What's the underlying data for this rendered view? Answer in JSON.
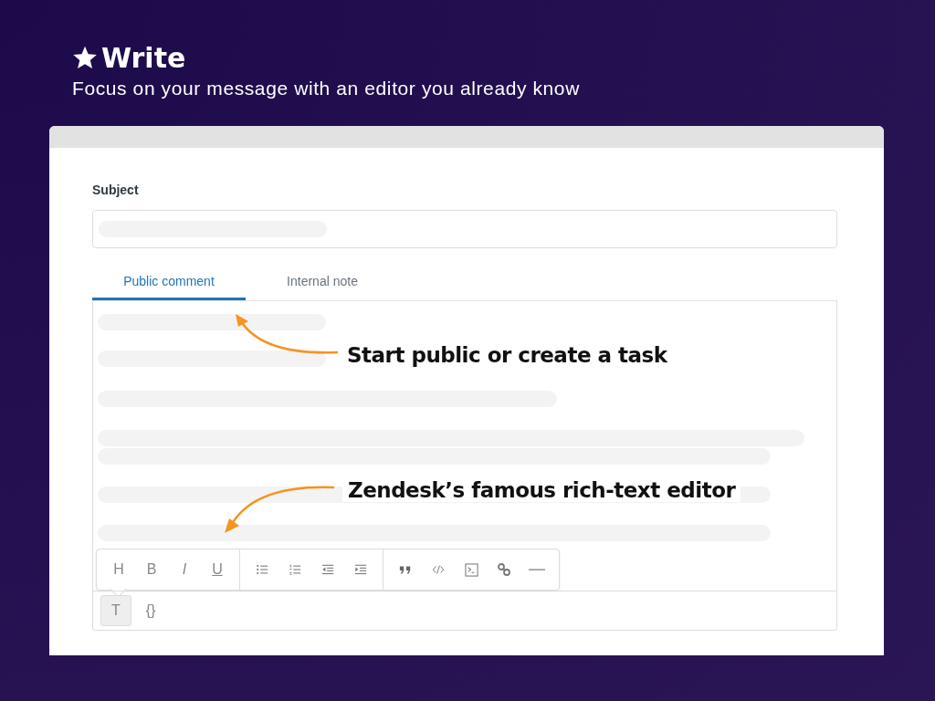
{
  "header": {
    "title": "Write",
    "subtitle": "Focus on your message with an editor you already know"
  },
  "form": {
    "subject_label": "Subject"
  },
  "tabs": [
    {
      "label": "Public comment",
      "selected": true
    },
    {
      "label": "Internal note",
      "selected": false
    }
  ],
  "annotations": [
    {
      "text": "Start public or create a task"
    },
    {
      "text": "Zendesk’s famous rich-text editor"
    }
  ],
  "toolbar": [
    [
      {
        "kind": "letter",
        "label": "H"
      },
      {
        "kind": "letter",
        "label": "B"
      },
      {
        "kind": "italic",
        "label": "I"
      },
      {
        "kind": "underline",
        "label": "U"
      }
    ],
    [
      {
        "kind": "bullets"
      },
      {
        "kind": "numbers"
      },
      {
        "kind": "outdent"
      },
      {
        "kind": "indent"
      }
    ],
    [
      {
        "kind": "quote"
      },
      {
        "kind": "code"
      },
      {
        "kind": "codeblock"
      },
      {
        "kind": "link"
      },
      {
        "kind": "rule"
      }
    ]
  ],
  "bottom_buttons": [
    {
      "label": "T",
      "selected": true
    },
    {
      "label": "{}",
      "selected": false
    }
  ]
}
